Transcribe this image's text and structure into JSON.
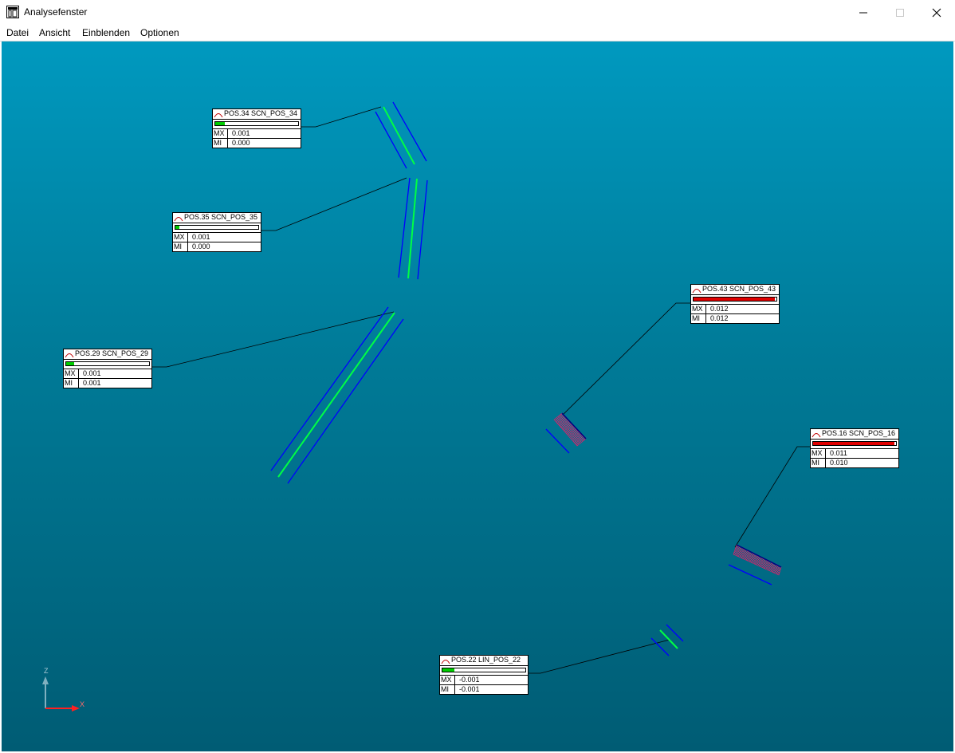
{
  "window": {
    "title": "Analysefenster",
    "controls": {
      "minimize": "—",
      "maximize": "☐",
      "close": "✕"
    }
  },
  "menu": {
    "items": [
      "Datei",
      "Ansicht",
      "Einblenden",
      "Optionen"
    ]
  },
  "axis": {
    "z_label": "Z",
    "x_label": "X"
  },
  "colors": {
    "viewport_top": "#0099bf",
    "viewport_bottom": "#005c74",
    "bar_low": "#00cc00",
    "bar_high": "#e00000",
    "member_outline": "#0000ff",
    "member_axis": "#00ff44",
    "hatch": "#e0206a"
  },
  "info_boxes": [
    {
      "id": "pos34",
      "title": "POS.34 SCN_POS_34",
      "bar_fraction": 0.12,
      "level": "low",
      "mx_label": "MX",
      "mx": "0.001",
      "mi_label": "MI",
      "mi": "0.000"
    },
    {
      "id": "pos35",
      "title": "POS.35 SCN_POS_35",
      "bar_fraction": 0.05,
      "level": "low",
      "mx_label": "MX",
      "mx": "0.001",
      "mi_label": "MI",
      "mi": "0.000"
    },
    {
      "id": "pos29",
      "title": "POS.29 SCN_POS_29",
      "bar_fraction": 0.1,
      "level": "low",
      "mx_label": "MX",
      "mx": "0.001",
      "mi_label": "MI",
      "mi": "0.001"
    },
    {
      "id": "pos43",
      "title": "POS.43 SCN_POS_43",
      "bar_fraction": 0.98,
      "level": "high",
      "mx_label": "MX",
      "mx": "0.012",
      "mi_label": "MI",
      "mi": "0.012"
    },
    {
      "id": "pos16",
      "title": "POS.16 SCN_POS_16",
      "bar_fraction": 0.98,
      "level": "high",
      "mx_label": "MX",
      "mx": "0.011",
      "mi_label": "MI",
      "mi": "0.010"
    },
    {
      "id": "pos22",
      "title": "POS.22 LIN_POS_22",
      "bar_fraction": 0.14,
      "level": "low",
      "mx_label": "MX",
      "mx": "-0.001",
      "mi_label": "MI",
      "mi": "-0.001"
    }
  ]
}
